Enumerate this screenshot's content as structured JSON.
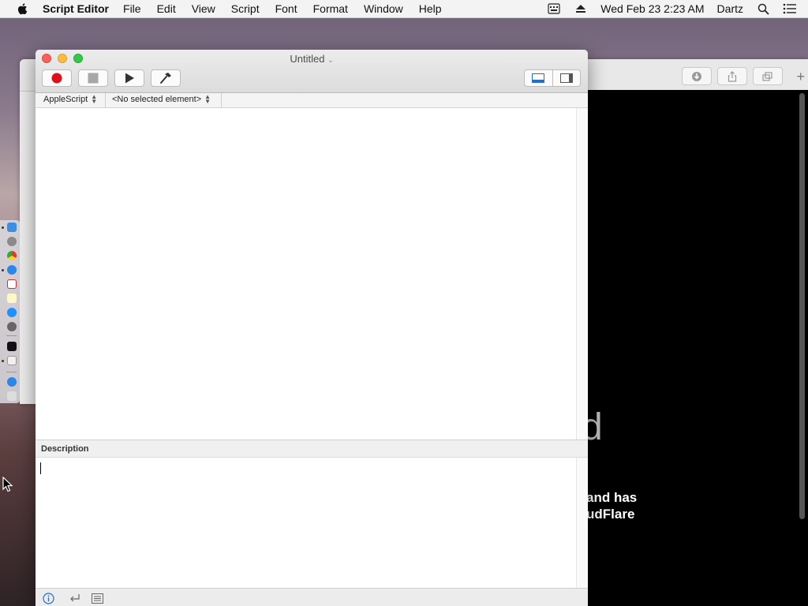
{
  "menubar": {
    "app_name": "Script Editor",
    "items": [
      "File",
      "Edit",
      "View",
      "Script",
      "Font",
      "Format",
      "Window",
      "Help"
    ],
    "clock": "Wed Feb 23  2:23 AM",
    "user": "Dartz",
    "icons": [
      "apple-icon",
      "keyboard-input-icon",
      "eject-icon",
      "spotlight-icon",
      "notification-center-icon"
    ]
  },
  "window": {
    "title": "Untitled",
    "toolbar": {
      "record": "record-icon",
      "stop": "stop-icon",
      "run": "run-icon",
      "compile": "hammer-icon",
      "view_toggle": [
        "bottom-pane-icon",
        "side-pane-icon"
      ]
    },
    "navigation": {
      "language": "AppleScript",
      "element": "<No selected element>"
    },
    "editor_text": "",
    "description_label": "Description",
    "description_text": "",
    "bottom_buttons": [
      "info-icon",
      "return-icon",
      "log-list-icon"
    ]
  },
  "background_window": {
    "partial_heading": "d",
    "partial_text": [
      "and has",
      "udFlare"
    ]
  }
}
